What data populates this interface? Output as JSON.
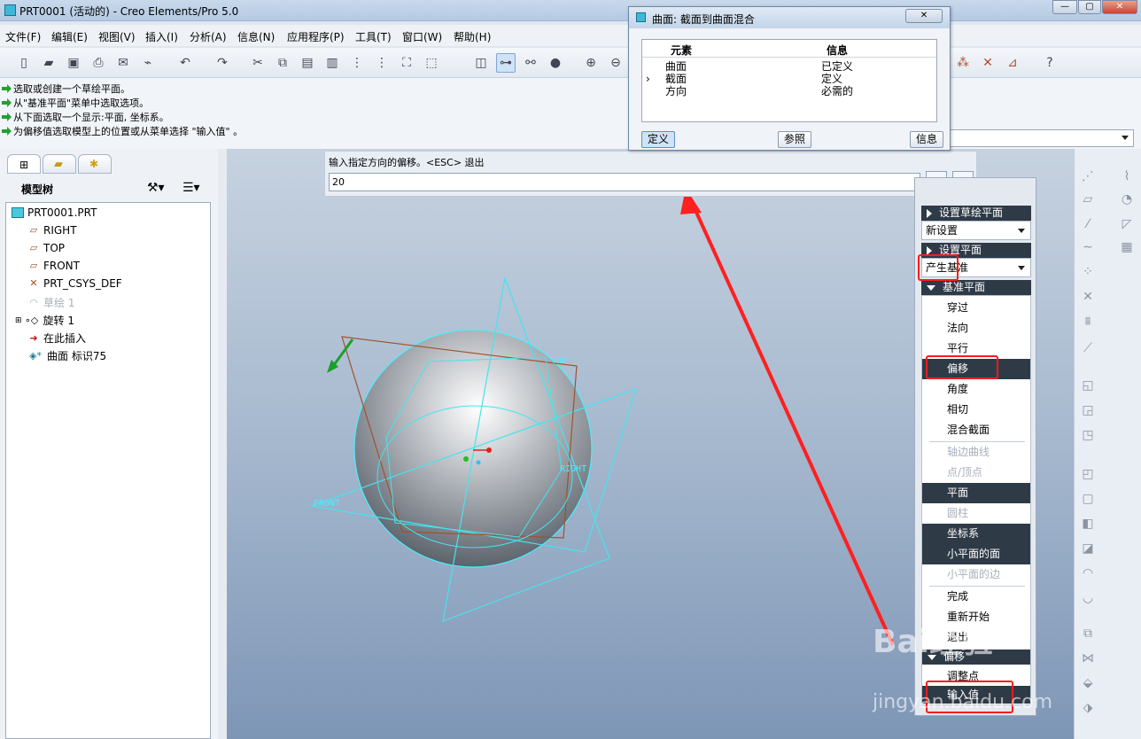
{
  "window": {
    "title": "PRT0001 (活动的) - Creo Elements/Pro 5.0",
    "buttons": [
      "—",
      "▢",
      "✕"
    ]
  },
  "menu": [
    "文件(F)",
    "编辑(E)",
    "视图(V)",
    "插入(I)",
    "分析(A)",
    "信息(N)",
    "应用程序(P)",
    "工具(T)",
    "窗口(W)",
    "帮助(H)"
  ],
  "messages": [
    "选取或创建一个草绘平面。",
    "从\"基准平面\"菜单中选取选项。",
    "从下面选取一个显示:平面, 坐标系。",
    "为偏移值选取模型上的位置或从菜单选择 \"输入值\" 。"
  ],
  "model_tree": {
    "header": "模型树",
    "items": [
      {
        "label": "PRT0001.PRT",
        "icon": "part-icon"
      },
      {
        "label": "RIGHT",
        "icon": "datum-plane-icon"
      },
      {
        "label": "TOP",
        "icon": "datum-plane-icon"
      },
      {
        "label": "FRONT",
        "icon": "datum-plane-icon"
      },
      {
        "label": "PRT_CSYS_DEF",
        "icon": "csys-icon"
      },
      {
        "label": "草绘 1",
        "icon": "sketch-icon"
      },
      {
        "label": "旋转 1",
        "icon": "revolve-icon"
      },
      {
        "label": "在此插入",
        "icon": "insert-here-icon"
      },
      {
        "label": "曲面 标识75",
        "icon": "surface-icon"
      }
    ]
  },
  "input_bar": {
    "label": "输入指定方向的偏移。<ESC> 退出",
    "value": "20",
    "ok": "✔",
    "cancel": "✖"
  },
  "dialog": {
    "title": "曲面: 截面到曲面混合",
    "col_element": "元素",
    "col_info": "信息",
    "rows": [
      {
        "el": "曲面",
        "info": "已定义"
      },
      {
        "el": "截面",
        "info": "定义"
      },
      {
        "el": "方向",
        "info": "必需的"
      }
    ],
    "buttons": {
      "define": "定义",
      "ref": "参照",
      "info": "信息"
    }
  },
  "viewport": {
    "labels": {
      "top": "TOP",
      "right": "RIGHT",
      "front": "FRONT"
    }
  },
  "menu_manager": {
    "h_sketch_setup": "设置草绘平面",
    "new_setup": "新设置",
    "h_set_plane": "设置平面",
    "make_datum": "产生基准",
    "h_datum_plane": "基准平面",
    "items": [
      {
        "label": "穿过",
        "state": "normal"
      },
      {
        "label": "法向",
        "state": "normal"
      },
      {
        "label": "平行",
        "state": "normal"
      },
      {
        "label": "偏移",
        "state": "selected"
      },
      {
        "label": "角度",
        "state": "normal"
      },
      {
        "label": "相切",
        "state": "normal"
      },
      {
        "label": "混合截面",
        "state": "normal"
      },
      {
        "label": "轴边曲线",
        "state": "disabled"
      },
      {
        "label": "点/顶点",
        "state": "disabled"
      },
      {
        "label": "平面",
        "state": "selected"
      },
      {
        "label": "圆柱",
        "state": "disabled"
      },
      {
        "label": "坐标系",
        "state": "selected"
      },
      {
        "label": "小平面的面",
        "state": "selected"
      },
      {
        "label": "小平面的边",
        "state": "disabled"
      },
      {
        "label": "完成",
        "state": "normal"
      },
      {
        "label": "重新开始",
        "state": "normal"
      },
      {
        "label": "退出",
        "state": "normal"
      }
    ],
    "h_offset": "偏移",
    "adjust": "调整点",
    "enter_value": "输入值"
  },
  "watermark": {
    "brand": "Bai经验",
    "url": "jingyan.baidu.com"
  },
  "colors": {
    "accent_red": "#ff1a1a",
    "menu_selected": "#2f3a47",
    "datum_cyan": "#38e6f0"
  }
}
